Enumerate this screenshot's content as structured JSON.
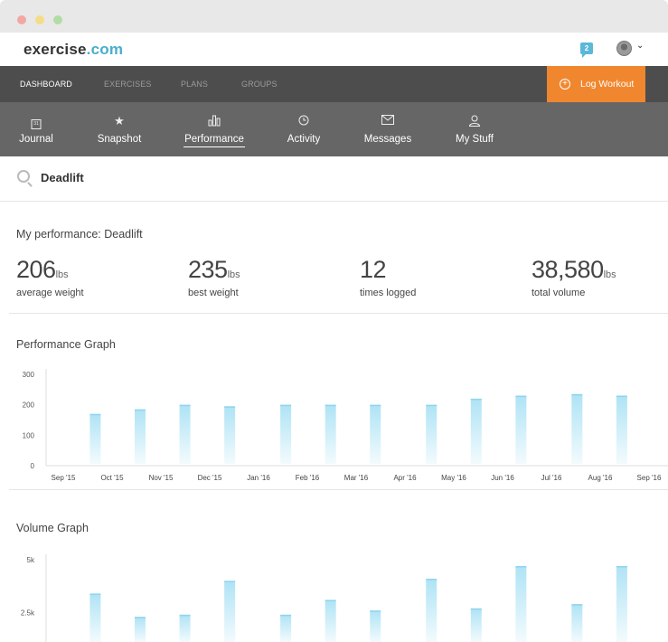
{
  "brand": {
    "name": "exercise",
    "tld": ".com"
  },
  "header": {
    "messages_count": "2"
  },
  "main_nav": {
    "items": [
      {
        "label": "DASHBOARD",
        "active": true
      },
      {
        "label": "EXERCISES",
        "active": false
      },
      {
        "label": "PLANS",
        "active": false
      },
      {
        "label": "GROUPS",
        "active": false
      }
    ],
    "log_workout_label": "Log Workout"
  },
  "sub_nav": {
    "tabs": [
      {
        "label": "Journal",
        "icon": "calendar-icon"
      },
      {
        "label": "Snapshot",
        "icon": "star-icon"
      },
      {
        "label": "Performance",
        "icon": "bar-chart-icon",
        "active": true
      },
      {
        "label": "Activity",
        "icon": "clock-icon"
      },
      {
        "label": "Messages",
        "icon": "envelope-icon"
      },
      {
        "label": "My Stuff",
        "icon": "person-icon"
      }
    ]
  },
  "search": {
    "value": "Deadlift"
  },
  "performance": {
    "title": "My performance: Deadlift",
    "stats": [
      {
        "value": "206",
        "unit": "lbs",
        "caption": "average weight"
      },
      {
        "value": "235",
        "unit": "lbs",
        "caption": "best weight"
      },
      {
        "value": "12",
        "unit": "",
        "caption": "times logged"
      },
      {
        "value": "38,580",
        "unit": "lbs",
        "caption": "total volume"
      }
    ]
  },
  "graphs": {
    "performance_title": "Performance Graph",
    "volume_title": "Volume Graph"
  },
  "colors": {
    "accent": "#f0872f",
    "brand": "#4aaecb",
    "bar": "#aee3f5"
  },
  "chart_data": [
    {
      "type": "bar",
      "title": "Performance Graph",
      "x": [
        "2015-09-21",
        "2015-10-19",
        "2015-11-16",
        "2015-12-14",
        "2016-01-18",
        "2016-02-15",
        "2016-03-14",
        "2016-04-18",
        "2016-05-16",
        "2016-06-13",
        "2016-07-18",
        "2016-08-15"
      ],
      "values": [
        170,
        185,
        200,
        195,
        200,
        200,
        200,
        200,
        220,
        230,
        235,
        230
      ],
      "xticks": [
        "Sep '15",
        "Oct '15",
        "Nov '15",
        "Dec '15",
        "Jan '16",
        "Feb '16",
        "Mar '16",
        "Apr '16",
        "May '16",
        "Jun '16",
        "Jul '16",
        "Aug '16",
        "Sep '16"
      ],
      "yticks": [
        "0",
        "100",
        "200",
        "300"
      ],
      "ylim": [
        0,
        300
      ]
    },
    {
      "type": "bar",
      "title": "Volume Graph",
      "x": [
        "2015-09-21",
        "2015-10-19",
        "2015-11-16",
        "2015-12-14",
        "2016-01-18",
        "2016-02-15",
        "2016-03-14",
        "2016-04-18",
        "2016-05-16",
        "2016-06-13",
        "2016-07-18",
        "2016-08-15"
      ],
      "values": [
        3400,
        2300,
        2400,
        4000,
        2400,
        3100,
        2600,
        4100,
        2700,
        4700,
        2900,
        4700
      ],
      "yticks": [
        "2.5k",
        "5k"
      ],
      "ylim": [
        0,
        5000
      ]
    }
  ]
}
